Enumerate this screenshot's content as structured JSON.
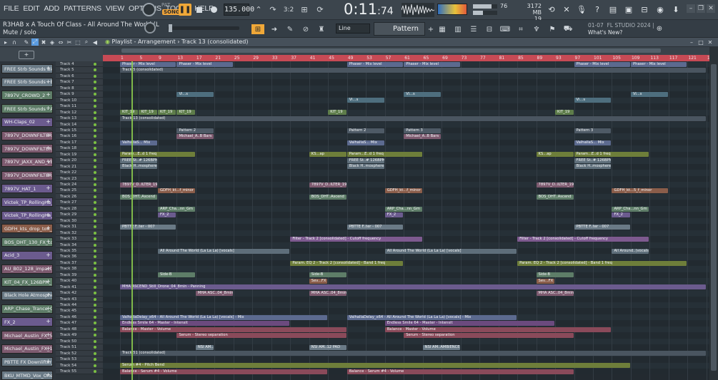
{
  "menu": [
    "FILE",
    "EDIT",
    "ADD",
    "PATTERNS",
    "VIEW",
    "OPTIONS",
    "TOOLS",
    "HELP"
  ],
  "transport": {
    "pat_label": "PAT",
    "song_label": "SONG",
    "tempo": "135.000",
    "time": "0:11",
    "time_frac": ":74",
    "time_sub": "M:S:CS"
  },
  "meters": {
    "cpu": "76",
    "memory": "3172 MB",
    "voices": "19"
  },
  "project": {
    "title": "R3HAB x A Touch Of Class - All Around The World (L",
    "hint": "Mute / solo"
  },
  "toolbar2": {
    "snap": "Line",
    "pattern": "Pattern 4"
  },
  "news": {
    "date": "01-07",
    "title_top": "FL STUDIO 2024 |",
    "title": "What's New?"
  },
  "playlist": {
    "breadcrumb": "Playlist - Arrangement",
    "separator": "›",
    "current_track": "Track 13 (consolidated)"
  },
  "timeline": {
    "bars": [
      "1",
      "5",
      "9",
      "13",
      "17",
      "21",
      "25",
      "29",
      "33",
      "37",
      "41",
      "45",
      "49",
      "53",
      "57",
      "61",
      "65",
      "69",
      "73",
      "77",
      "81",
      "85",
      "89",
      "93",
      "97",
      "101",
      "105",
      "109",
      "113",
      "117",
      "121",
      "125"
    ]
  },
  "picker": [
    {
      "label": "FREE Strb Sounds Big_",
      "color": "#6a7a86"
    },
    {
      "label": "FREE Strb Sounds - B_",
      "color": "#6a7a86"
    },
    {
      "label": "7897V_CROWD_2",
      "color": "#5e7d68"
    },
    {
      "label": "FREE Strb Sounds - A_",
      "color": "#5e7d68"
    },
    {
      "label": "WH-Claps_02",
      "color": "#6b5b8e"
    },
    {
      "label": "7897V_DOWNFILTER_",
      "color": "#7d5a6f"
    },
    {
      "label": "7897V_DOWNFILTER_",
      "color": "#7d5a6f"
    },
    {
      "label": "7897V_JAXX_AND_VE_",
      "color": "#7d5a6f"
    },
    {
      "label": "7897V_DOWNFILTER_",
      "color": "#7d5a6f"
    },
    {
      "label": "7897V_HAT_1",
      "color": "#6b5b8e"
    },
    {
      "label": "Victek_TP_RollingHa_",
      "color": "#6b5b8e"
    },
    {
      "label": "Victek_TP_RollingHa_",
      "color": "#6b5b8e"
    },
    {
      "label": "GDFH_kts_drop_ton_",
      "color": "#8a5d4a"
    },
    {
      "label": "BOS_DHT_130_FX_Lo_",
      "color": "#5e7d68"
    },
    {
      "label": "Acid_3",
      "color": "#6b5b8e"
    },
    {
      "label": "AU_B02_128_impact_",
      "color": "#7d5a6f"
    },
    {
      "label": "KIT_04_FX_126BPM_",
      "color": "#5e7d68"
    },
    {
      "label": "Black Hole Atmosphe_",
      "color": "#6a7a86"
    },
    {
      "label": "ARP_Chase_Trance_G_",
      "color": "#5e7d68"
    },
    {
      "label": "FX_2",
      "color": "#6b5b8e"
    },
    {
      "label": "Michael_Austin_FX_5_",
      "color": "#7d5a6f"
    },
    {
      "label": "Michael_Austin_FX_1_",
      "color": "#7d5a6f"
    },
    {
      "label": "PBTTE FX Downlifter_",
      "color": "#6a7a86"
    },
    {
      "label": "BKU_MTMD_Vox_One_",
      "color": "#6a7a86"
    }
  ],
  "tracks": [
    "Track 4",
    "Track 5",
    "Track 6",
    "Track 7",
    "Track 8",
    "Track 9",
    "Track 10",
    "Track 11",
    "Track 12",
    "Track 13",
    "Track 14",
    "Track 15",
    "Track 16",
    "Track 17",
    "Track 18",
    "Track 19",
    "Track 20",
    "Track 21",
    "Track 22",
    "Track 23",
    "Track 24",
    "Track 25",
    "Track 26",
    "Track 27",
    "Track 28",
    "Track 29",
    "Track 30",
    "Track 31",
    "Track 32",
    "Track 33",
    "Track 34",
    "Track 35",
    "Track 36",
    "Track 37",
    "Track 38",
    "Track 39",
    "Track 40",
    "Track 41",
    "Track 42",
    "Track 43",
    "Track 44",
    "Track 45",
    "Track 46",
    "Track 47",
    "Track 48",
    "Track 49",
    "Track 50",
    "Track 51",
    "Track 52",
    "Track 53",
    "Track 54",
    "Track 55"
  ],
  "clips": [
    {
      "row": 0,
      "start": 1,
      "len": 12,
      "label": "Phaser - Mix level",
      "color": "#5c6a8f"
    },
    {
      "row": 0,
      "start": 13,
      "len": 12,
      "label": "Phaser - Mix level",
      "color": "#5c6a8f"
    },
    {
      "row": 0,
      "start": 49,
      "len": 12,
      "label": "Phaser - Mix level",
      "color": "#5c6a8f"
    },
    {
      "row": 0,
      "start": 61,
      "len": 12,
      "label": "Phaser - Mix level",
      "color": "#5c6a8f"
    },
    {
      "row": 0,
      "start": 97,
      "len": 12,
      "label": "Phaser - Mix level",
      "color": "#5c6a8f"
    },
    {
      "row": 0,
      "start": 109,
      "len": 12,
      "label": "Phaser - Mix level",
      "color": "#5c6a8f"
    },
    {
      "row": 1,
      "start": 1,
      "len": 124,
      "label": "Track 5 (consolidated)",
      "color": "#4a5560"
    },
    {
      "row": 5,
      "start": 13,
      "len": 8,
      "label": "Vi...s",
      "color": "#4e6e7e"
    },
    {
      "row": 5,
      "start": 61,
      "len": 8,
      "label": "Vi...s",
      "color": "#4e6e7e"
    },
    {
      "row": 5,
      "start": 109,
      "len": 8,
      "label": "Vi...s",
      "color": "#4e6e7e"
    },
    {
      "row": 6,
      "start": 49,
      "len": 8,
      "label": "Vi...s",
      "color": "#4e6e7e"
    },
    {
      "row": 6,
      "start": 97,
      "len": 8,
      "label": "Vi...s",
      "color": "#4e6e7e"
    },
    {
      "row": 8,
      "start": 1,
      "len": 4,
      "label": "KIT_19",
      "color": "#5e7d4a"
    },
    {
      "row": 8,
      "start": 5,
      "len": 4,
      "label": "KIT_19",
      "color": "#5e7d4a"
    },
    {
      "row": 8,
      "start": 9,
      "len": 4,
      "label": "KIT_19",
      "color": "#5e7d4a"
    },
    {
      "row": 8,
      "start": 13,
      "len": 4,
      "label": "KIT_19",
      "color": "#5e7d4a"
    },
    {
      "row": 8,
      "start": 45,
      "len": 4,
      "label": "KIT_19",
      "color": "#5e7d4a"
    },
    {
      "row": 8,
      "start": 93,
      "len": 4,
      "label": "KIT_19",
      "color": "#5e7d4a"
    },
    {
      "row": 9,
      "start": 1,
      "len": 124,
      "label": "Track 13 (consolidated)",
      "color": "#4a5560"
    },
    {
      "row": 11,
      "start": 13,
      "len": 8,
      "label": "Pattern 2",
      "color": "#4e5a66"
    },
    {
      "row": 11,
      "start": 49,
      "len": 8,
      "label": "Pattern 2",
      "color": "#4e5a66"
    },
    {
      "row": 11,
      "start": 61,
      "len": 8,
      "label": "Pattern 3",
      "color": "#4e5a66"
    },
    {
      "row": 11,
      "start": 97,
      "len": 8,
      "label": "Pattern 3",
      "color": "#4e5a66"
    },
    {
      "row": 12,
      "start": 13,
      "len": 8,
      "label": "Michael_A..B Bars",
      "color": "#7d5a6f"
    },
    {
      "row": 12,
      "start": 61,
      "len": 8,
      "label": "Michael_A..B Bars",
      "color": "#7d5a6f"
    },
    {
      "row": 13,
      "start": 1,
      "len": 8,
      "label": "ValhallaS... Mix",
      "color": "#5c6a8f"
    },
    {
      "row": 13,
      "start": 49,
      "len": 8,
      "label": "ValhallaS... Mix",
      "color": "#5c6a8f"
    },
    {
      "row": 13,
      "start": 97,
      "len": 8,
      "label": "ValhallaS... Mix",
      "color": "#5c6a8f"
    },
    {
      "row": 15,
      "start": 1,
      "len": 16,
      "label": "Param...E..d 1 freq",
      "color": "#6e7e3a"
    },
    {
      "row": 15,
      "start": 41,
      "len": 8,
      "label": "KS...ap",
      "color": "#6e7e3a"
    },
    {
      "row": 15,
      "start": 49,
      "len": 16,
      "label": "Param...E..d 1 freq",
      "color": "#6e7e3a"
    },
    {
      "row": 15,
      "start": 89,
      "len": 8,
      "label": "KS...ap",
      "color": "#6e7e3a"
    },
    {
      "row": 15,
      "start": 97,
      "len": 16,
      "label": "Param...E..d 1 freq",
      "color": "#6e7e3a"
    },
    {
      "row": 16,
      "start": 1,
      "len": 8,
      "label": "FREE St..# 126BPM",
      "color": "#5e6e7a"
    },
    {
      "row": 16,
      "start": 49,
      "len": 8,
      "label": "FREE St..# 126BPM",
      "color": "#5e6e7a"
    },
    {
      "row": 16,
      "start": 97,
      "len": 8,
      "label": "FREE St..# 126BPM",
      "color": "#5e6e7a"
    },
    {
      "row": 17,
      "start": 1,
      "len": 8,
      "label": "Black H..mosphere",
      "color": "#5e6e7a"
    },
    {
      "row": 17,
      "start": 49,
      "len": 8,
      "label": "Black H..mosphere",
      "color": "#5e6e7a"
    },
    {
      "row": 17,
      "start": 97,
      "len": 8,
      "label": "Black H..mosphere",
      "color": "#5e6e7a"
    },
    {
      "row": 20,
      "start": 1,
      "len": 8,
      "label": "7897V_D..ILTER_19",
      "color": "#7d5a6f"
    },
    {
      "row": 20,
      "start": 41,
      "len": 8,
      "label": "7897V_D..ILTER_19",
      "color": "#7d5a6f"
    },
    {
      "row": 20,
      "start": 89,
      "len": 8,
      "label": "7897V_D..ILTER_19",
      "color": "#7d5a6f"
    },
    {
      "row": 21,
      "start": 9,
      "len": 8,
      "label": "GDFH_kt...f_minor",
      "color": "#8a5d4a"
    },
    {
      "row": 21,
      "start": 57,
      "len": 8,
      "label": "GDFH_kt...f_minor",
      "color": "#8a5d4a"
    },
    {
      "row": 21,
      "start": 105,
      "len": 12,
      "label": "GDFH_kt...5_f_minor",
      "color": "#8a5d4a"
    },
    {
      "row": 22,
      "start": 1,
      "len": 8,
      "label": "BOS_DHT..Ascend",
      "color": "#5e7d68"
    },
    {
      "row": 22,
      "start": 41,
      "len": 8,
      "label": "BOS_DHT..Ascend",
      "color": "#5e7d68"
    },
    {
      "row": 22,
      "start": 89,
      "len": 8,
      "label": "BOS_DHT..Ascend",
      "color": "#5e7d68"
    },
    {
      "row": 24,
      "start": 9,
      "len": 8,
      "label": "ARP_Cha...nn_Gm",
      "color": "#5e7d68"
    },
    {
      "row": 24,
      "start": 57,
      "len": 8,
      "label": "ARP_Cha...nn_Gm",
      "color": "#5e7d68"
    },
    {
      "row": 24,
      "start": 105,
      "len": 8,
      "label": "ARP_Cha...nn_Gm",
      "color": "#5e7d68"
    },
    {
      "row": 25,
      "start": 9,
      "len": 4,
      "label": "FX_2",
      "color": "#6b5b8e"
    },
    {
      "row": 25,
      "start": 57,
      "len": 4,
      "label": "FX_2",
      "color": "#6b5b8e"
    },
    {
      "row": 25,
      "start": 105,
      "len": 4,
      "label": "FX_2",
      "color": "#6b5b8e"
    },
    {
      "row": 27,
      "start": 1,
      "len": 12,
      "label": "PBTTE F..ter - 007",
      "color": "#6a7a86"
    },
    {
      "row": 27,
      "start": 49,
      "len": 12,
      "label": "PBTTE F..ter - 007",
      "color": "#6a7a86"
    },
    {
      "row": 27,
      "start": 97,
      "len": 12,
      "label": "PBTTE F..ter - 007",
      "color": "#6a7a86"
    },
    {
      "row": 29,
      "start": 37,
      "len": 28,
      "label": "Filter - Track 2 [consolidated] - Cutoff frequency",
      "color": "#7d5a8f"
    },
    {
      "row": 29,
      "start": 85,
      "len": 28,
      "label": "Filter - Track 2 [consolidated] - Cutoff frequency",
      "color": "#7d5a8f"
    },
    {
      "row": 31,
      "start": 9,
      "len": 28,
      "label": "All Around The World (La La La) [vocals]",
      "color": "#5e6e7a"
    },
    {
      "row": 31,
      "start": 57,
      "len": 28,
      "label": "All Around The World (La La La) [vocals]",
      "color": "#5e6e7a"
    },
    {
      "row": 31,
      "start": 105,
      "len": 8,
      "label": "All Around..(vocals)",
      "color": "#5e6e7a"
    },
    {
      "row": 33,
      "start": 37,
      "len": 24,
      "label": "Param. EQ 2 - Track 2 [consolidated] - Band 1 freq",
      "color": "#6e7e3a"
    },
    {
      "row": 33,
      "start": 85,
      "len": 36,
      "label": "Param. EQ 2 - Track 2 [consolidated] - Band 1 freq",
      "color": "#6e7e3a"
    },
    {
      "row": 35,
      "start": 9,
      "len": 8,
      "label": "Side-B",
      "color": "#5e7d68"
    },
    {
      "row": 35,
      "start": 41,
      "len": 8,
      "label": "Side-B",
      "color": "#5e7d68"
    },
    {
      "row": 35,
      "start": 89,
      "len": 8,
      "label": "Side-B",
      "color": "#5e7d68"
    },
    {
      "row": 36,
      "start": 41,
      "len": 4,
      "label": "Sev...FX",
      "color": "#8a5d4a"
    },
    {
      "row": 36,
      "start": 89,
      "len": 4,
      "label": "Sev...FX",
      "color": "#8a5d4a"
    },
    {
      "row": 37,
      "start": 1,
      "len": 124,
      "label": "MHA ASCEND_Still_Drone_04_8min - Panning",
      "color": "#6b5b8e"
    },
    {
      "row": 38,
      "start": 17,
      "len": 8,
      "label": "MHA ASC..04_8min",
      "color": "#7d5a6f"
    },
    {
      "row": 38,
      "start": 41,
      "len": 8,
      "label": "MHA ASC..04_8min",
      "color": "#7d5a6f"
    },
    {
      "row": 38,
      "start": 89,
      "len": 8,
      "label": "MHA ASC..04_8min",
      "color": "#7d5a6f"
    },
    {
      "row": 42,
      "start": 1,
      "len": 44,
      "label": "ValhallaDelay_x64 - All Around The World (La La La) [vocals] - Mix",
      "color": "#5c6a8f"
    },
    {
      "row": 42,
      "start": 49,
      "len": 36,
      "label": "ValhallaDelay_x64 - All Around The World (La La La) [vocals] - Mix",
      "color": "#5c6a8f"
    },
    {
      "row": 43,
      "start": 1,
      "len": 36,
      "label": "Endless Smile 64 - Master - Intensit",
      "color": "#6b4a7e"
    },
    {
      "row": 43,
      "start": 57,
      "len": 36,
      "label": "Endless Smile 64 - Master - Intensit",
      "color": "#6b4a7e"
    },
    {
      "row": 44,
      "start": 1,
      "len": 48,
      "label": "Balance - Master - Volume",
      "color": "#8a4a5a"
    },
    {
      "row": 44,
      "start": 57,
      "len": 48,
      "label": "Balance - Master - Volume",
      "color": "#8a4a5a"
    },
    {
      "row": 45,
      "start": 13,
      "len": 36,
      "label": "Serum - Stereo separation",
      "color": "#8a4a5a"
    },
    {
      "row": 45,
      "start": 61,
      "len": 36,
      "label": "Serum - Stereo separation",
      "color": "#8a4a5a"
    },
    {
      "row": 47,
      "start": 17,
      "len": 4,
      "label": "NSI AM..AMBIENCE PAD",
      "color": "#6a7a86"
    },
    {
      "row": 47,
      "start": 41,
      "len": 8,
      "label": "NSI AM..12 PAD",
      "color": "#6a7a86"
    },
    {
      "row": 47,
      "start": 65,
      "len": 8,
      "label": "NSI AM..AMBIENCE PAD",
      "color": "#6a7a86"
    },
    {
      "row": 48,
      "start": 1,
      "len": 124,
      "label": "Track 51 (consolidated)",
      "color": "#4a5560"
    },
    {
      "row": 50,
      "start": 1,
      "len": 108,
      "label": "Serum #4 - Pitch Bend",
      "color": "#6e7e3a"
    },
    {
      "row": 51,
      "start": 1,
      "len": 44,
      "label": "Balance - Serum #4 - Volume",
      "color": "#8a4a5a"
    },
    {
      "row": 51,
      "start": 49,
      "len": 48,
      "label": "Balance - Serum #4 - Volume",
      "color": "#8a4a5a"
    }
  ],
  "colors": {
    "accent": "#f0a838",
    "ruler": "#c74a55",
    "playhead": "#8fd14f",
    "grid_bg": "#232a30"
  }
}
